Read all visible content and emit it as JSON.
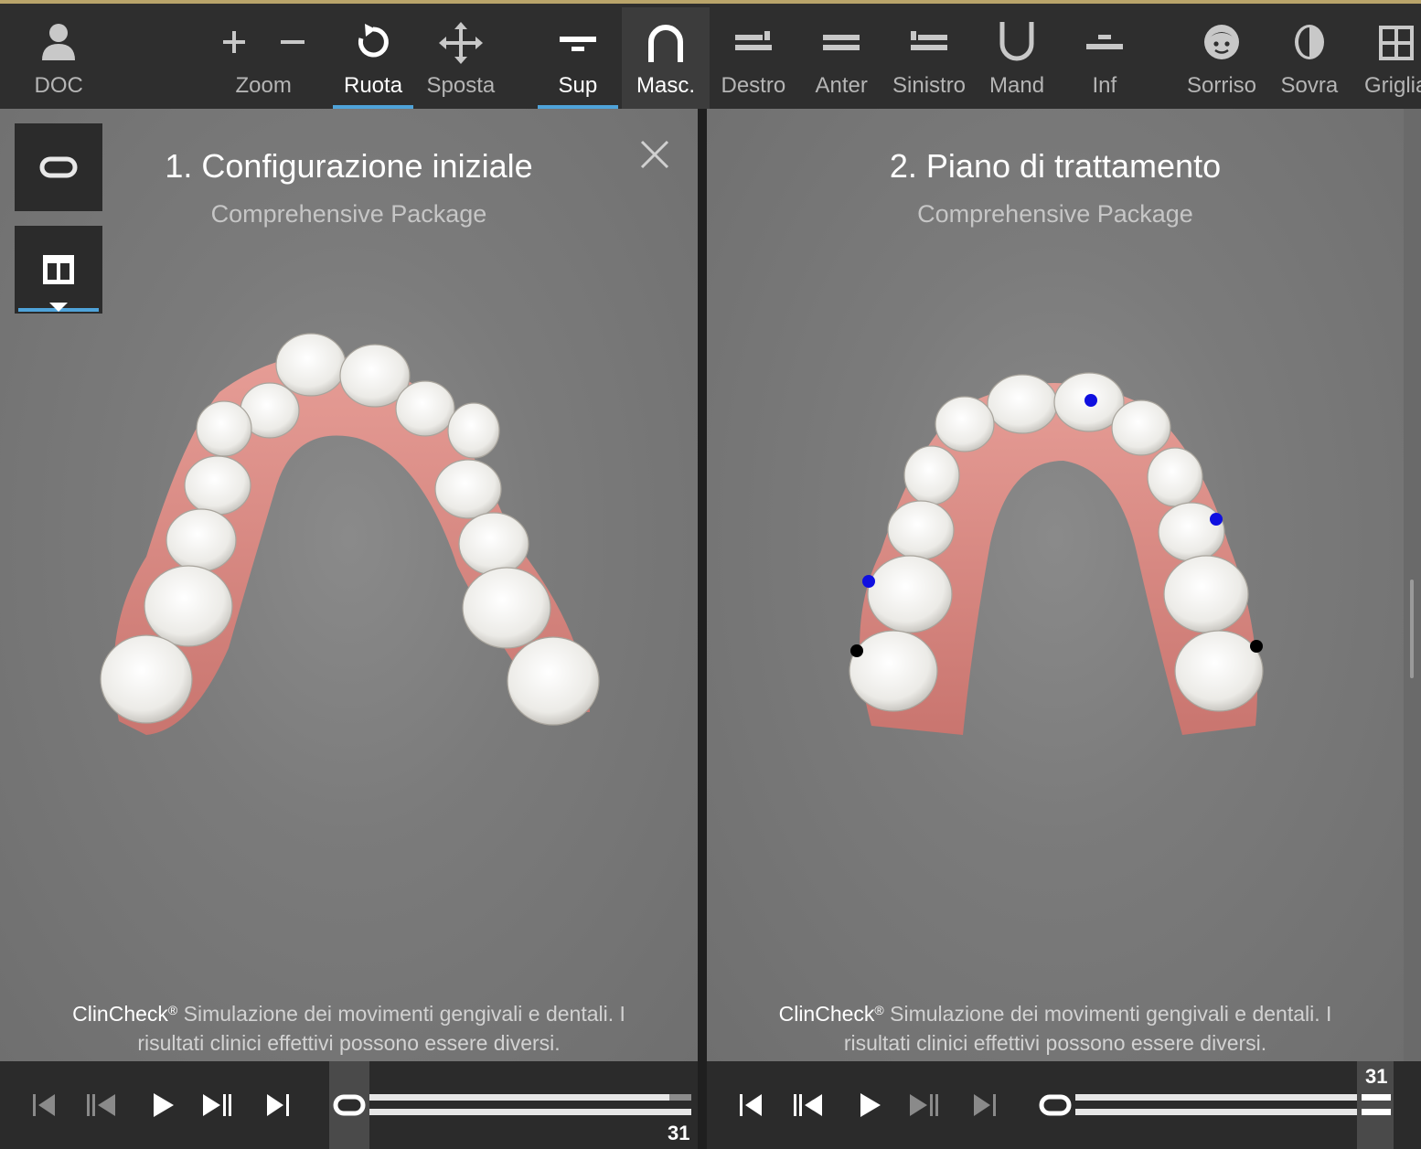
{
  "toolbar": {
    "doc": "DOC",
    "zoom": "Zoom",
    "ruota": "Ruota",
    "sposta": "Sposta",
    "sup": "Sup",
    "masc": "Masc.",
    "destro": "Destro",
    "anter": "Anter",
    "sinistro": "Sinistro",
    "mand": "Mand",
    "inf": "Inf",
    "sorriso": "Sorriso",
    "sovra": "Sovra",
    "griglia": "Griglia"
  },
  "left_panel": {
    "title": "1. Configurazione iniziale",
    "subtitle": "Comprehensive Package",
    "disclaimer_brand": "ClinCheck",
    "disclaimer_reg": "®",
    "disclaimer_line1": " Simulazione dei movimenti gengivali e dentali. I",
    "disclaimer_line2": "risultati clinici effettivi possono essere diversi."
  },
  "right_panel": {
    "title": "2. Piano di trattamento",
    "subtitle": "Comprehensive Package",
    "disclaimer_brand": "ClinCheck",
    "disclaimer_reg": "®",
    "disclaimer_line1": " Simulazione dei movimenti gengivali e dentali. I",
    "disclaimer_line2": "risultati clinici effettivi possono essere diversi."
  },
  "player_left": {
    "stage": "31",
    "progress": 0.0
  },
  "player_right": {
    "stage": "31",
    "progress": 1.0
  },
  "colors": {
    "accent": "#4fa3d9",
    "gum": "#d98d86",
    "tooth": "#f0eeea",
    "marker_blue": "#1010e0",
    "marker_black": "#000000"
  }
}
